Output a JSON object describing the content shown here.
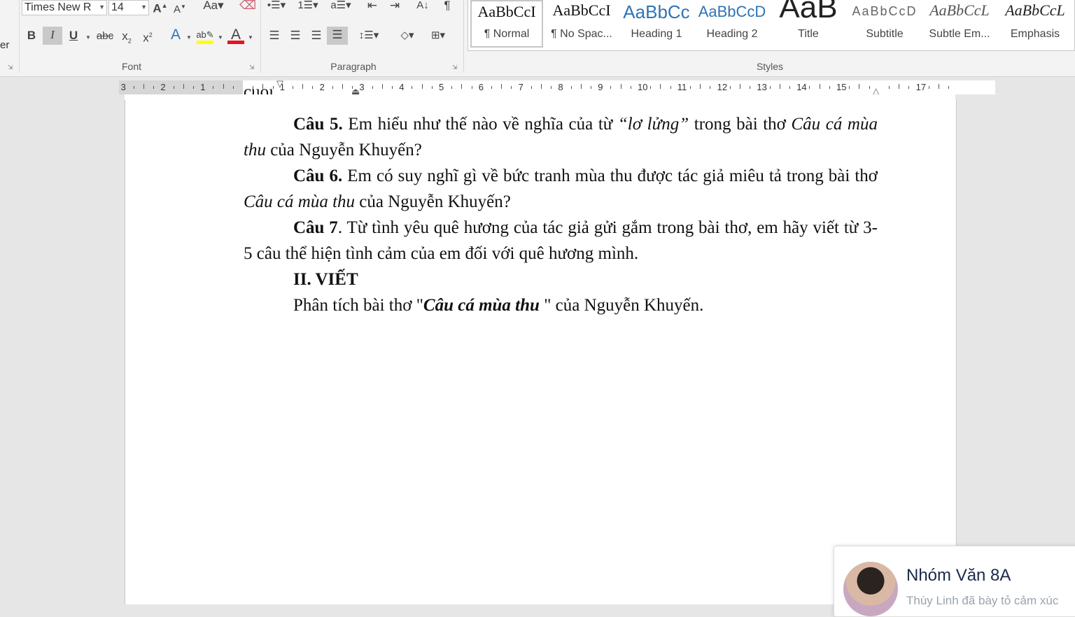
{
  "ribbon": {
    "edge_label": "er",
    "font_name": "Times New R",
    "font_size": "14",
    "groups": {
      "font": "Font",
      "paragraph": "Paragraph",
      "styles": "Styles"
    },
    "styles": [
      {
        "preview": "AaBbCcI",
        "name": "¶ Normal"
      },
      {
        "preview": "AaBbCcI",
        "name": "¶ No Spac..."
      },
      {
        "preview": "AaBbCc",
        "name": "Heading 1"
      },
      {
        "preview": "AaBbCcD",
        "name": "Heading 2"
      },
      {
        "preview": "AaB",
        "name": "Title"
      },
      {
        "preview": "AaBbCcD",
        "name": "Subtitle"
      },
      {
        "preview": "AaBbCcL",
        "name": "Subtle Em..."
      },
      {
        "preview": "AaBbCcL",
        "name": "Emphasis"
      }
    ],
    "colors": {
      "highlight": "#ffff00",
      "font_color": "#e81123",
      "heading_blue": "#2e74b5"
    }
  },
  "ruler": {
    "numbers": [
      "3",
      "2",
      "1",
      "1",
      "2",
      "3",
      "4",
      "5",
      "6",
      "7",
      "8",
      "9",
      "10",
      "11",
      "12",
      "13",
      "14",
      "15",
      "17"
    ]
  },
  "document": {
    "top_fragment": "cuối.",
    "q5": {
      "label": "Câu 5.",
      "t1": " Em hiểu như thế nào về nghĩa của từ ",
      "q": "“lơ lửng”",
      "t2": " trong bài thơ ",
      "it": "Câu cá mùa thu",
      "t3": " của Nguyễn Khuyến?"
    },
    "q6": {
      "label": "Câu 6.",
      "t1": " Em có suy nghĩ gì về bức tranh mùa thu được tác giả miêu tả trong bài thơ ",
      "it": "Câu cá mùa thu",
      "t2": " của Nguyễn Khuyến?"
    },
    "q7": {
      "label": "Câu 7",
      "t1": ". Từ tình yêu quê hương của tác giả gửi gắm trong bài thơ, em hãy viết từ 3- 5 câu thể hiện tình cảm của em đối với quê hương mình."
    },
    "section": "II. VIẾT",
    "task": {
      "t1": "Phân tích bài thơ  \"",
      "bi": "Câu cá mùa thu",
      "t2": " \" của Nguyễn Khuyến."
    }
  },
  "notification": {
    "title": "Nhóm Văn 8A",
    "subtitle": "Thùy Linh đã bày tỏ cảm xúc"
  }
}
